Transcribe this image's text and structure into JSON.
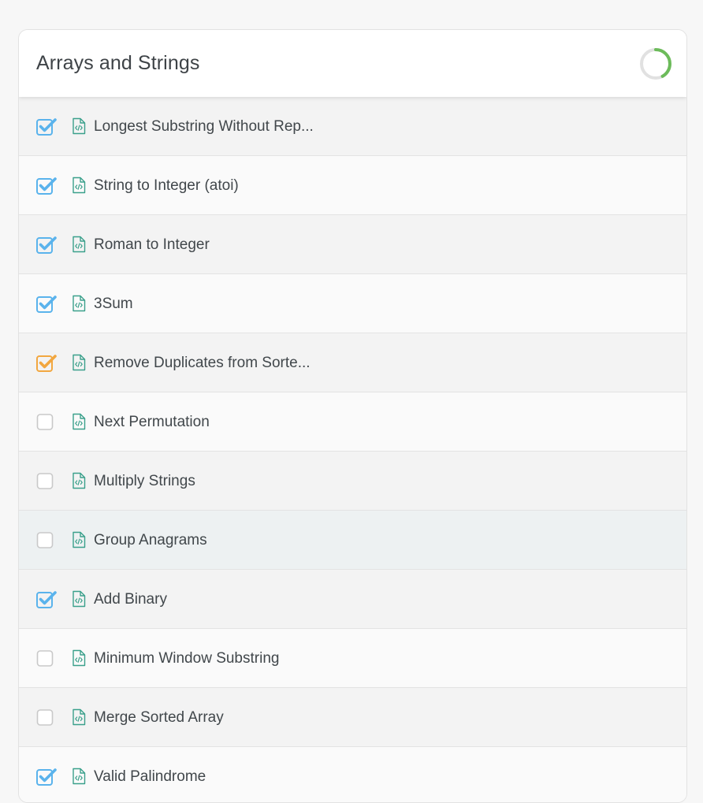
{
  "section": {
    "title": "Arrays and Strings",
    "progress_fraction": 0.42
  },
  "colors": {
    "checked": "#5ab3ec",
    "in_progress": "#f2a740",
    "progress_ring": "#6cbb5a",
    "file_icon": "#3aa08b"
  },
  "items": [
    {
      "label": "Longest Substring Without Rep...",
      "state": "checked"
    },
    {
      "label": "String to Integer (atoi)",
      "state": "checked"
    },
    {
      "label": "Roman to Integer",
      "state": "checked"
    },
    {
      "label": "3Sum",
      "state": "checked"
    },
    {
      "label": "Remove Duplicates from Sorte...",
      "state": "in_progress"
    },
    {
      "label": "Next Permutation",
      "state": "unchecked"
    },
    {
      "label": "Multiply Strings",
      "state": "unchecked"
    },
    {
      "label": "Group Anagrams",
      "state": "unchecked"
    },
    {
      "label": "Add Binary",
      "state": "checked"
    },
    {
      "label": "Minimum Window Substring",
      "state": "unchecked"
    },
    {
      "label": "Merge Sorted Array",
      "state": "unchecked"
    },
    {
      "label": "Valid Palindrome",
      "state": "checked"
    }
  ]
}
